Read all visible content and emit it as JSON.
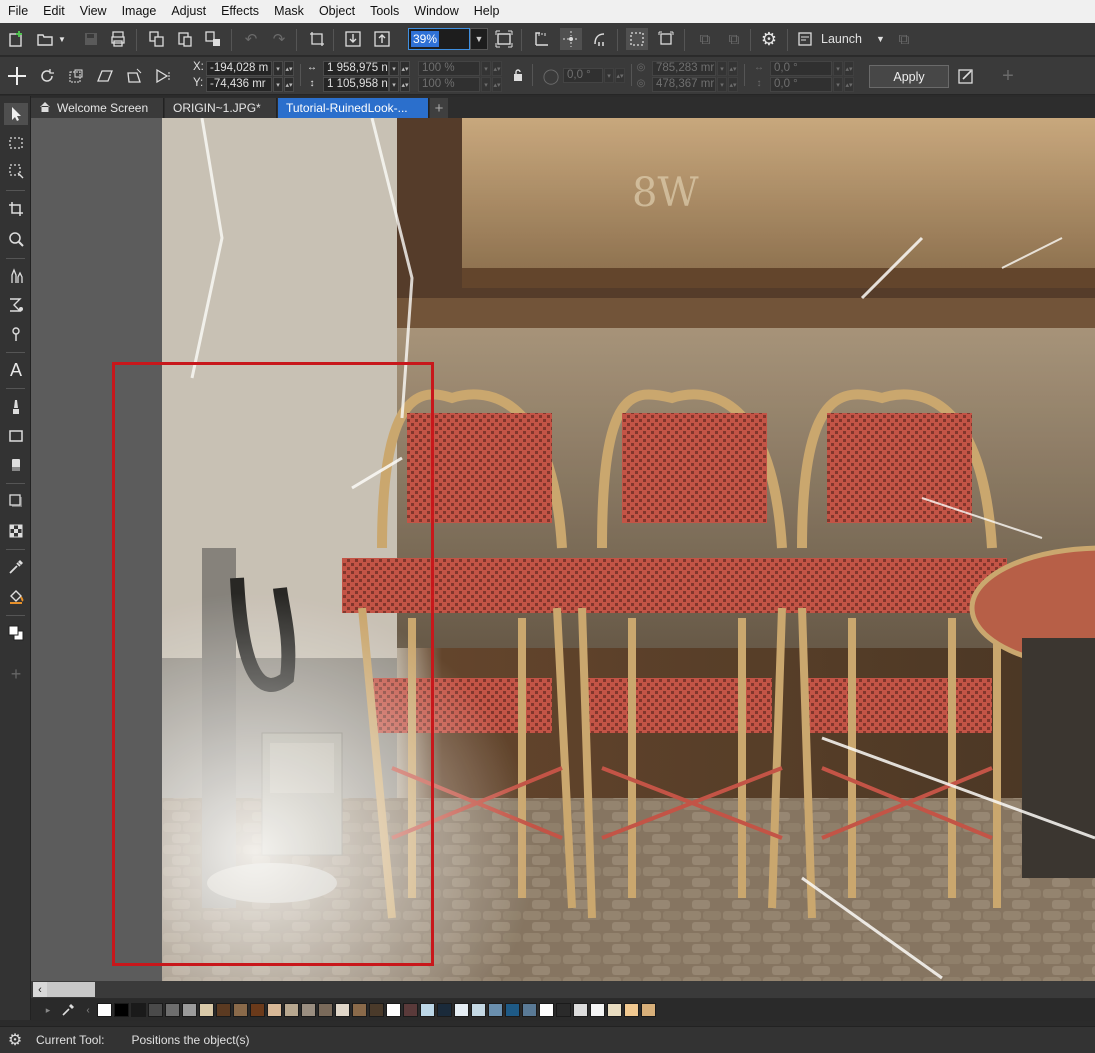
{
  "menu": [
    "File",
    "Edit",
    "View",
    "Image",
    "Adjust",
    "Effects",
    "Mask",
    "Object",
    "Tools",
    "Window",
    "Help"
  ],
  "toolbar": {
    "zoom_value": "39%",
    "launch_label": "Launch"
  },
  "property_bar": {
    "x_label": "X:",
    "x_value": "-194,028 m",
    "y_label": "Y:",
    "y_value": "-74,436 mr",
    "width_value": "1 958,975 n",
    "height_value": "1 105,958 n",
    "scale_w": "100 %",
    "scale_h": "100 %",
    "rotation": "0,0 °",
    "center_x": "785,283 mr",
    "center_y": "478,367 mr",
    "skew_h": "0,0 °",
    "skew_v": "0,0 °",
    "apply_label": "Apply"
  },
  "tabs": [
    {
      "label": "Welcome Screen",
      "active": false
    },
    {
      "label": "ORIGIN~1.JPG*",
      "active": false
    },
    {
      "label": "Tutorial-RuinedLook-...",
      "active": true
    }
  ],
  "canvas": {
    "photo_sign_text": "8W"
  },
  "palette_colors": [
    "#ffffff",
    "#000000",
    "#1a1a1a",
    "#4a4a4a",
    "#6e6e6e",
    "#9b9b9b",
    "#d9c9a8",
    "#5b3a21",
    "#8a6a4a",
    "#6b3a1a",
    "#d8b896",
    "#b8a890",
    "#9a8e80",
    "#7a6a5a",
    "#e0d6c8",
    "#8a6a4a",
    "#4a3a2a",
    "#ffffff",
    "#5a3a3a",
    "#bcd6e6",
    "#1a2a3a",
    "#e6eef4",
    "#c4d8e4",
    "#6a8fae",
    "#1e5a86",
    "#5a7a96",
    "#ffffff",
    "#2a2a2a",
    "#dcdcdc",
    "#f4f4f4",
    "#e8dcc0",
    "#f0c890",
    "#d8b07a"
  ],
  "status": {
    "label": "Current Tool:",
    "value": "Positions the object(s)"
  }
}
